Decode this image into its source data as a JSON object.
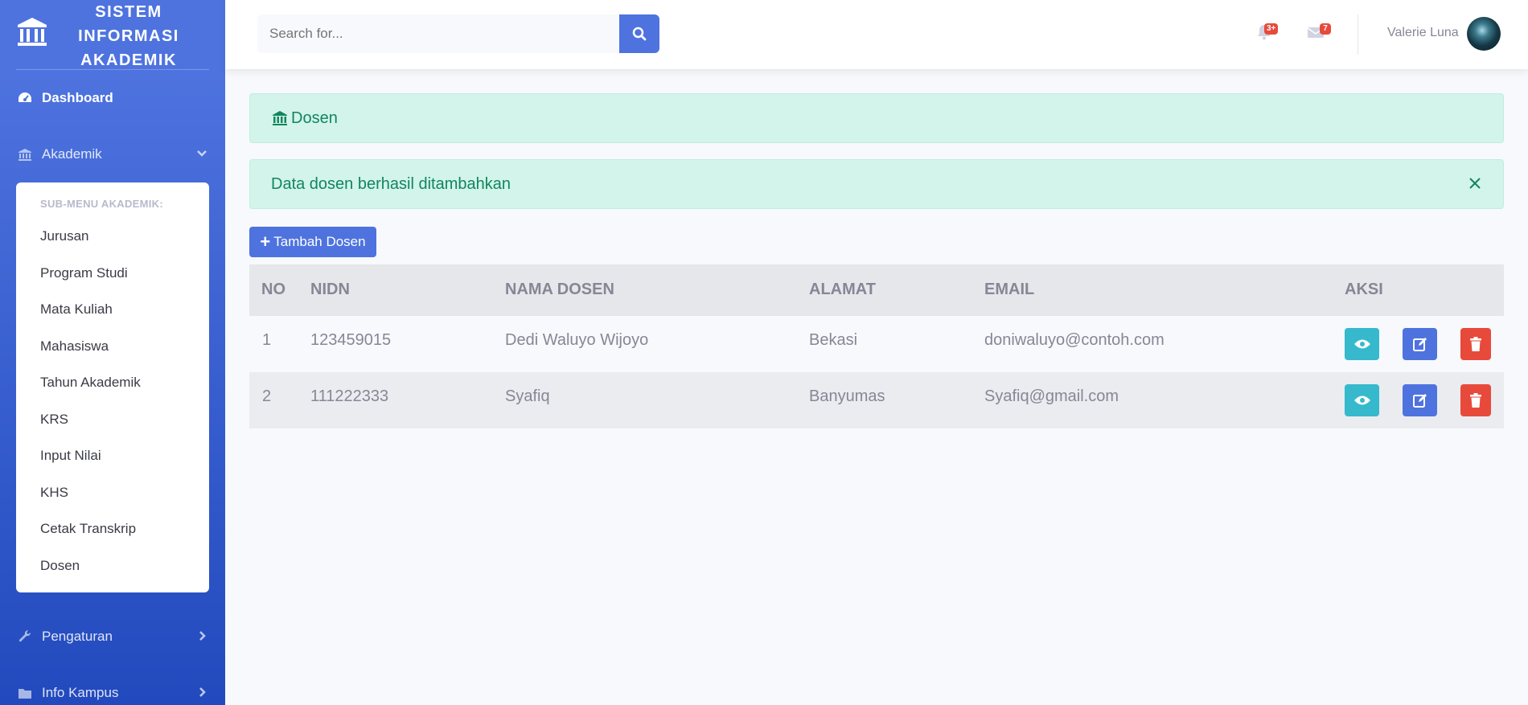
{
  "brand": {
    "lines": [
      "SISTEM",
      "INFORMASI",
      "AKADEMIK"
    ]
  },
  "sidebar": {
    "dashboard": "Dashboard",
    "akademik": "Akademik",
    "submenu_header": "SUB-MENU AKADEMIK:",
    "submenu": [
      "Jurusan",
      "Program Studi",
      "Mata Kuliah",
      "Mahasiswa",
      "Tahun Akademik",
      "KRS",
      "Input Nilai",
      "KHS",
      "Cetak Transkrip",
      "Dosen"
    ],
    "pengaturan": "Pengaturan",
    "info_kampus": "Info Kampus"
  },
  "topbar": {
    "search_placeholder": "Search for...",
    "alerts_badge": "3+",
    "messages_badge": "7",
    "user_name": "Valerie Luna"
  },
  "page": {
    "heading": "Dosen",
    "success_message": "Data dosen berhasil ditambahkan",
    "add_button": "Tambah Dosen"
  },
  "table": {
    "headers": {
      "no": "NO",
      "nidn": "NIDN",
      "nama": "NAMA DOSEN",
      "alamat": "ALAMAT",
      "email": "EMAIL",
      "aksi": "AKSI"
    },
    "rows": [
      {
        "no": "1",
        "nidn": "123459015",
        "nama": "Dedi Waluyo Wijoyo",
        "alamat": "Bekasi",
        "email": "doniwaluyo@contoh.com"
      },
      {
        "no": "2",
        "nidn": "111222333",
        "nama": "Syafiq",
        "alamat": "Banyumas",
        "email": "Syafiq@gmail.com"
      }
    ]
  },
  "colors": {
    "primary": "#4e73df",
    "info": "#36b9cc",
    "danger": "#e74a3b",
    "success_bg": "#d2f4ea",
    "success_text": "#13855c"
  },
  "icons": [
    "university-icon",
    "dashboard-icon",
    "chevron-down-icon",
    "chevron-right-icon",
    "wrench-icon",
    "folder-icon",
    "search-icon",
    "bell-icon",
    "envelope-icon",
    "close-icon",
    "plus-icon",
    "eye-icon",
    "edit-icon",
    "trash-icon"
  ]
}
